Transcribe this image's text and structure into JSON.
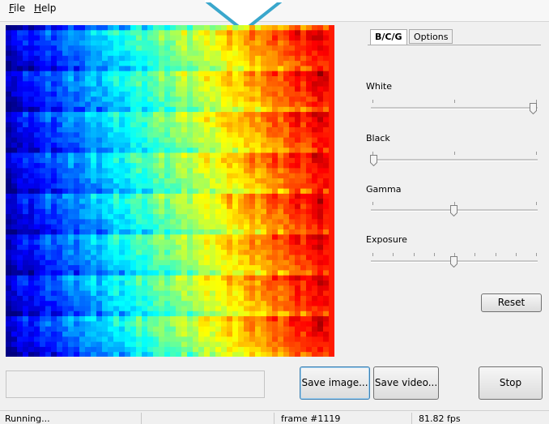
{
  "menu": {
    "file": "File",
    "help": "Help"
  },
  "tabs": [
    {
      "label": "B/C/G",
      "active": true
    },
    {
      "label": "Options",
      "active": false
    }
  ],
  "sliders": [
    {
      "label": "White",
      "value": 1.0
    },
    {
      "label": "Black",
      "value": 0.0
    },
    {
      "label": "Gamma",
      "value": 0.5
    },
    {
      "label": "Exposure",
      "value": 0.5
    }
  ],
  "buttons": {
    "reset": "Reset",
    "save_image": "Save image...",
    "save_video": "Save video...",
    "stop": "Stop"
  },
  "status": {
    "state": "Running...",
    "frame": "frame #1119",
    "fps": "81.82 fps"
  },
  "colors": {
    "callout": "#3aa7cc",
    "focus_border": "#3c7fb1"
  }
}
